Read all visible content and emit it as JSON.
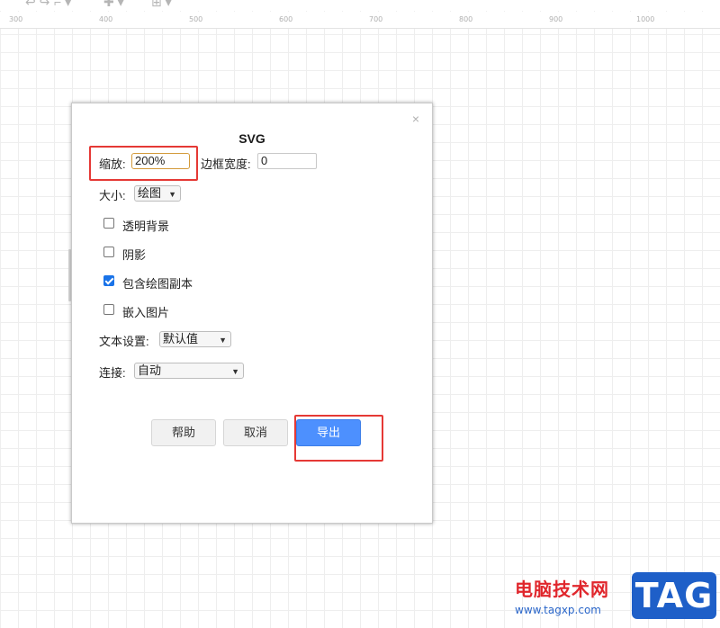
{
  "ruler": {
    "ticks": [
      "300",
      "400",
      "500",
      "600",
      "700",
      "800",
      "900",
      "1000"
    ]
  },
  "dialog": {
    "title": "SVG",
    "close_symbol": "×",
    "scale_label": "缩放:",
    "scale_value": "200%",
    "border_label": "边框宽度:",
    "border_value": "0",
    "size_label": "大小:",
    "size_value": "绘图",
    "transparent_label": "透明背景",
    "transparent_checked": false,
    "shadow_label": "阴影",
    "shadow_checked": false,
    "include_copy_label": "包含绘图副本",
    "include_copy_checked": true,
    "embed_images_label": "嵌入图片",
    "embed_images_checked": false,
    "text_settings_label": "文本设置:",
    "text_settings_value": "默认值",
    "link_label": "连接:",
    "link_value": "自动",
    "help_button": "帮助",
    "cancel_button": "取消",
    "export_button": "导出"
  },
  "watermark": {
    "text": "电脑技术网",
    "url": "www.tagxp.com",
    "logo": "TAG"
  },
  "colors": {
    "accent_button": "#4d90fe",
    "highlight_box": "#e53935",
    "focus_border": "#d39a3a"
  }
}
